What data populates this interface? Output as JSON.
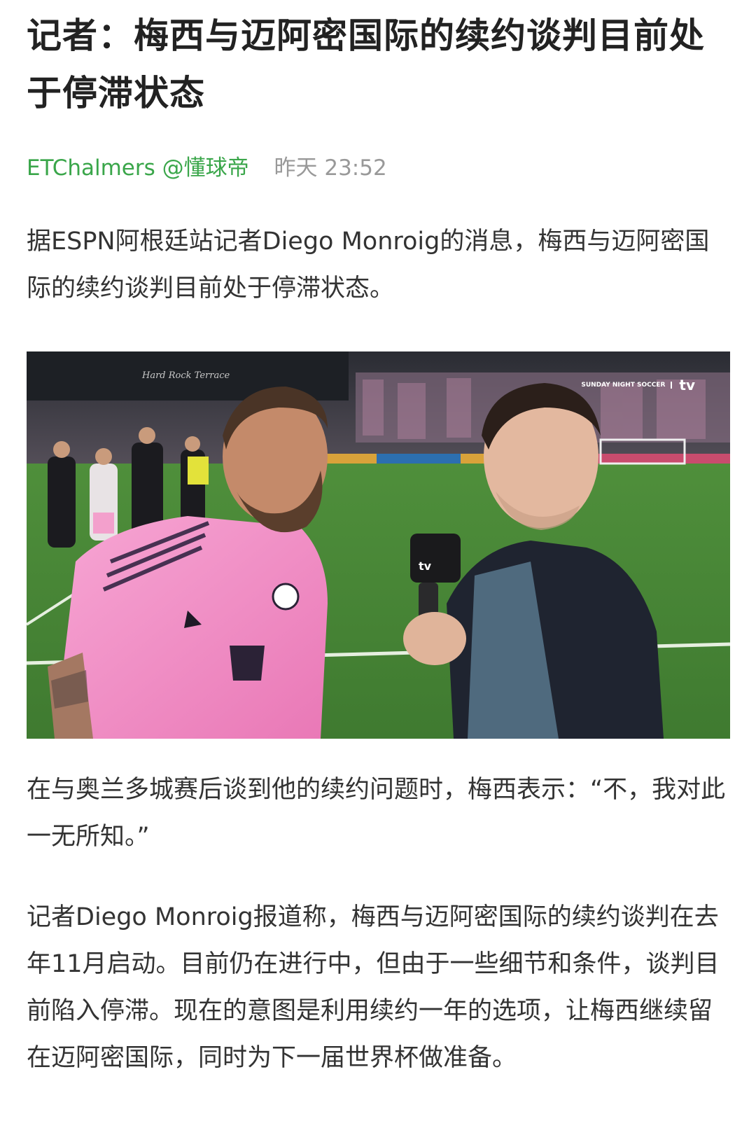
{
  "article": {
    "title": "记者：梅西与迈阿密国际的续约谈判目前处于停滞状态",
    "author": "ETChalmers",
    "source": "@懂球帝",
    "time": "昨天 23:52",
    "paragraphs": [
      "据ESPN阿根廷站记者Diego Monroig的消息，梅西与迈阿密国际的续约谈判目前处于停滞状态。",
      "在与奥兰多城赛后谈到他的续约问题时，梅西表示：“不，我对此一无所知。”",
      "记者Diego Monroig报道称，梅西与迈阿密国际的续约谈判在去年11月启动。目前仍在进行中，但由于一些细节和条件，谈判目前陷入停滞。现在的意图是利用续约一年的选项，让梅西继续留在迈阿密国际，同时为下一届世界杯做准备。"
    ]
  },
  "photo": {
    "broadcast_tag": "SUNDAY NIGHT SOCCER",
    "tv_brand": "tv",
    "stadium_sign": "Hard Rock Terrace",
    "mic_brand": "tv"
  },
  "colors": {
    "title": "#222222",
    "author": "#3aa64a",
    "time": "#999999",
    "body_text": "#333333",
    "pink_jersey": "#f08cc4"
  },
  "icons": {
    "apple_logo": "apple-icon"
  }
}
